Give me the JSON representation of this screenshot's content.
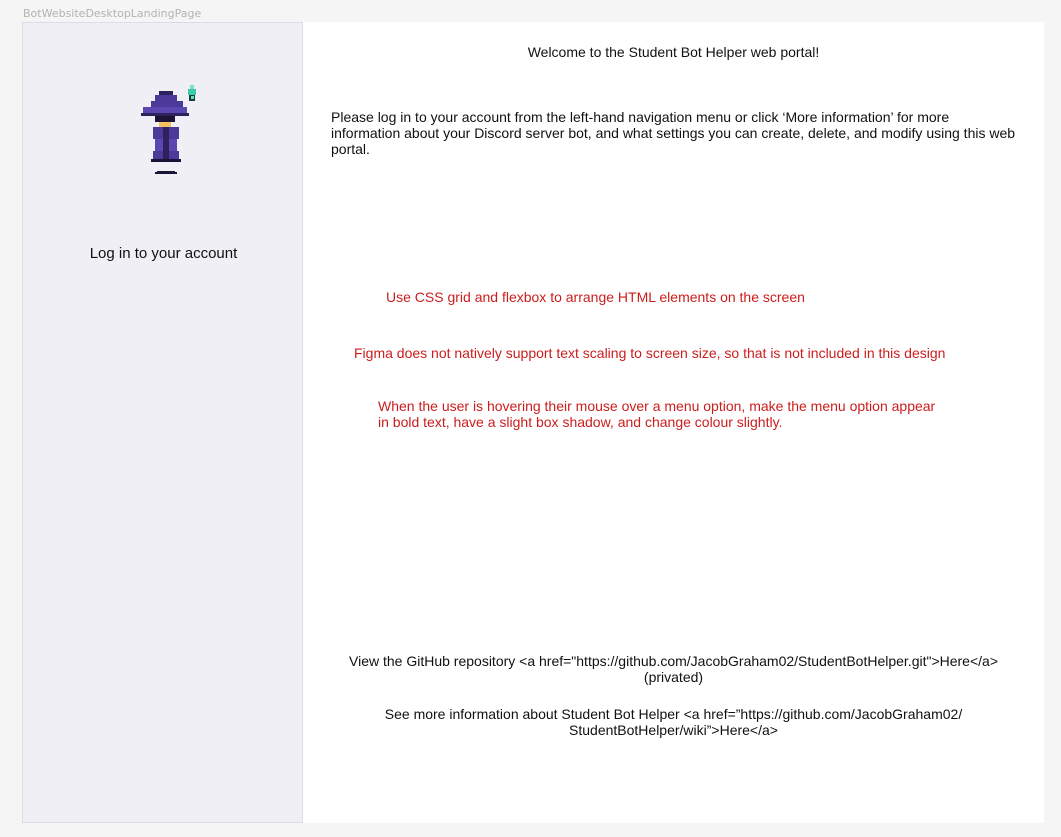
{
  "frame": {
    "label": "BotWebsiteDesktopLandingPage"
  },
  "sidebar": {
    "logo_icon": "wizard-bot-icon",
    "login_label": "Log in to your account"
  },
  "main": {
    "welcome": "Welcome to the Student Bot Helper web portal!",
    "intro": "Please log in to your account from the left-hand navigation menu or click ‘More information’ for more information about your Discord server bot, and what settings you can create, delete, and modify using this web portal.",
    "notes": [
      "Use CSS grid and flexbox to arrange HTML elements on the screen",
      "Figma does not natively support text scaling to screen size, so that is not included in this design",
      "When the user is hovering their mouse over a menu option, make the menu option appear in bold text, have a slight box shadow, and change colour slightly."
    ],
    "github_line1": "View the GitHub repository <a href=\"https://github.com/JacobGraham02/StudentBotHelper.git\">Here</a>",
    "github_line2": "(privated)",
    "info_line1": "See more information about Student Bot Helper <a href=”https://github.com/JacobGraham02/",
    "info_line2": "StudentBotHelper/wiki”>Here</a>"
  },
  "colors": {
    "background": "#f5f5f5",
    "sidebar": "#efeff5",
    "note_red": "#cc1d1d",
    "wizard_purple": "#4b3a9a"
  }
}
